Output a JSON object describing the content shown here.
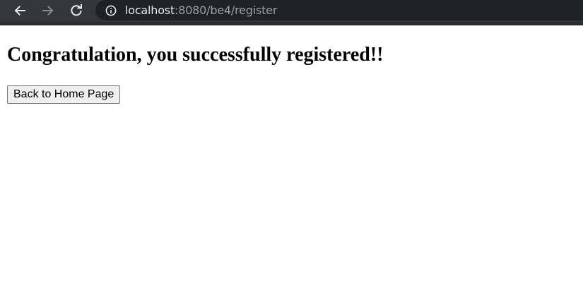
{
  "browser": {
    "url_host": "localhost",
    "url_rest": ":8080/be4/register",
    "icons": {
      "back": "back-arrow-icon",
      "forward": "forward-arrow-icon",
      "reload": "reload-icon",
      "info": "info-icon"
    },
    "colors": {
      "toolbar": "#35363a",
      "omnibox": "#202124",
      "url_host": "#e8eaed",
      "url_rest": "#9aa0a6"
    }
  },
  "page": {
    "title": "Congratulation, you successfully registered!!",
    "home_button_label": "Back to Home Page"
  }
}
